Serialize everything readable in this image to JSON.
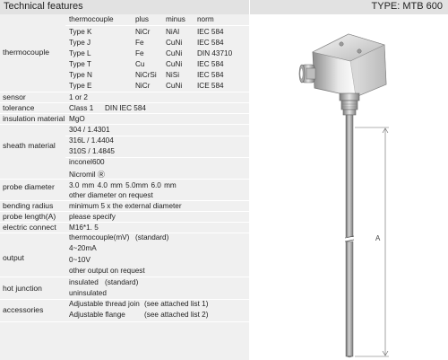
{
  "header": {
    "title": "Technical features",
    "type_label": "TYPE: MTB 600"
  },
  "thermocouple": {
    "label": "thermocouple",
    "columns": [
      "thermocouple",
      "plus",
      "minus",
      "norm"
    ],
    "rows": [
      [
        "Type K",
        "NiCr",
        "NiAl",
        "IEC 584"
      ],
      [
        "Type J",
        "Fe",
        "CuNi",
        "IEC 584"
      ],
      [
        "Type L",
        "Fe",
        "CuNi",
        "DIN 43710"
      ],
      [
        "Type T",
        "Cu",
        "CuNi",
        "IEC 584"
      ],
      [
        "Type N",
        "NiCrSi",
        "NiSi",
        "IEC 584"
      ],
      [
        "Type E",
        "NiCr",
        "CuNi",
        "ICE 584"
      ]
    ]
  },
  "sensor": {
    "label": "sensor",
    "value": "1 or 2"
  },
  "tolerance": {
    "label": "tolerance",
    "class": "Class 1",
    "norm": "DIN IEC 584"
  },
  "insulation": {
    "label": "insulation material",
    "value": "MgO"
  },
  "sheath": {
    "label": "sheath material",
    "values": [
      "304 / 1.4301",
      "316L / 1.4404",
      "310S / 1.4845",
      "inconel600",
      "Nicromil Ⓡ"
    ]
  },
  "probe_diameter": {
    "label": "probe diameter",
    "values": "3.0 mm   4.0 mm   5.0mm   6.0 mm",
    "note": "other diameter on request"
  },
  "bending_radius": {
    "label": "bending radius",
    "value": "minimum 5 x the external diameter"
  },
  "probe_length": {
    "label": "probe length(A)",
    "value": "please specify"
  },
  "electric_connect": {
    "label": "electric connect",
    "value": "M16*1. 5"
  },
  "output": {
    "label": "output",
    "line1": "thermocouple(mV)",
    "line1_note": "(standard)",
    "values": [
      "4~20mA",
      "0~10V",
      "other output on request"
    ]
  },
  "hot_junction": {
    "label": "hot junction",
    "line1": "insulated",
    "line1_note": "(standard)",
    "line2": "uninsulated"
  },
  "accessories": {
    "label": "accessories",
    "items": [
      {
        "name": "Adjustable thread join",
        "note": "(see attached list 1)"
      },
      {
        "name": "Adjustable flange",
        "note": "(see attached list 2)"
      }
    ]
  },
  "drawing": {
    "dimension_label": "A"
  }
}
